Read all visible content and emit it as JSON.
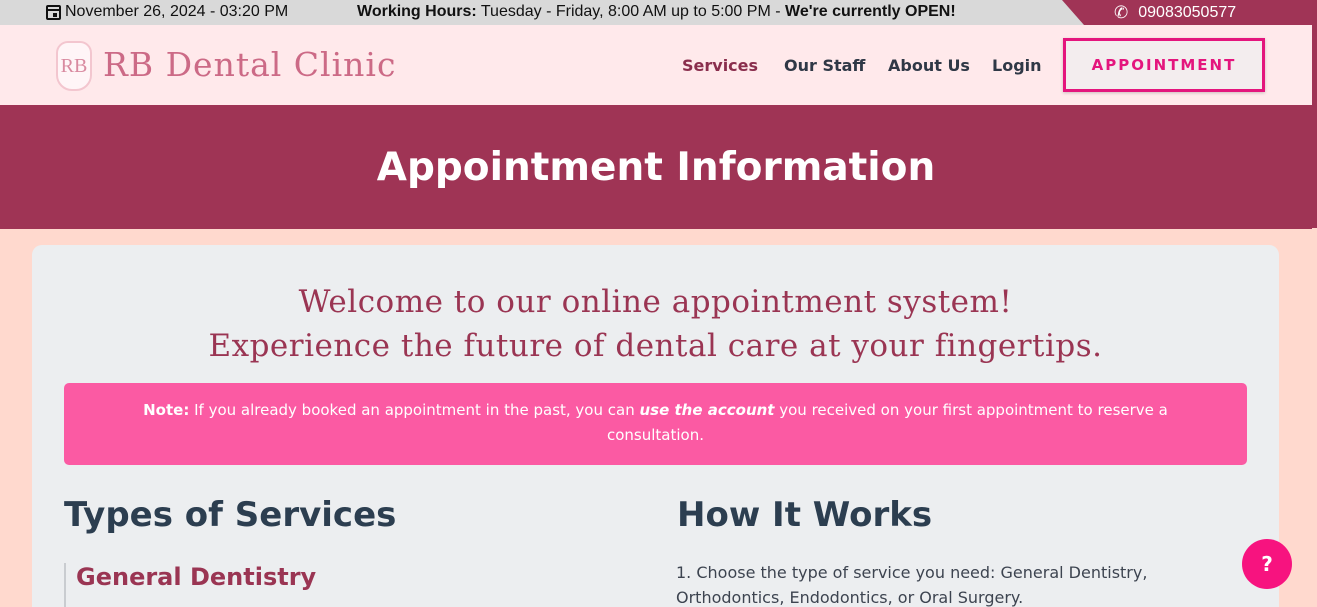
{
  "topbar": {
    "date": "November 26, 2024 - 03:20 PM",
    "hours_label": "Working Hours:",
    "hours_text": " Tuesday - Friday, 8:00 AM up to 5:00 PM - ",
    "open_status": "We're currently OPEN!",
    "phone": "09083050577"
  },
  "header": {
    "logo_letters": "RB",
    "brand": "RB Dental Clinic",
    "nav": {
      "services": "Services",
      "staff": "Our Staff",
      "about": "About Us",
      "login": "Login"
    },
    "appointment_button": "APPOINTMENT"
  },
  "banner": {
    "title": "Appointment Information"
  },
  "main": {
    "welcome_line1": "Welcome to our online appointment system!",
    "welcome_line2": "Experience the future of dental care at your fingertips.",
    "note": {
      "label": "Note:",
      "text1": " If you already booked an appointment in the past, you can ",
      "emphasis": "use the account",
      "text2": " you received on your first appointment to reserve a consultation."
    },
    "services_title": "Types of Services",
    "first_service": "General Dentistry",
    "how_title": "How It Works",
    "step1": "1. Choose the type of service you need: General Dentistry, Orthodontics, Endodontics, or Oral Surgery."
  },
  "help_button": "?",
  "colors": {
    "accent": "#9f3455",
    "pink": "#fb5aa3",
    "button": "#e4157d"
  }
}
